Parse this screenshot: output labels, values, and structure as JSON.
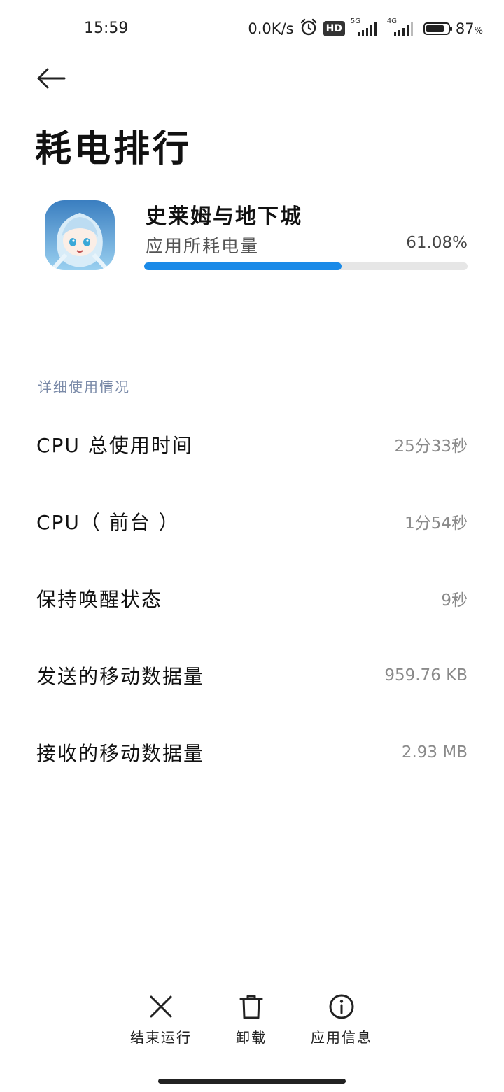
{
  "status_bar": {
    "time": "15:59",
    "network_speed": "0.0K/s",
    "hd_badge": "HD",
    "signal_1_label": "5G",
    "signal_2_label": "4G",
    "battery_level": 0.87,
    "battery_text": "87",
    "battery_unit": "%"
  },
  "header": {
    "title": "耗电排行"
  },
  "app": {
    "name": "史莱姆与地下城",
    "usage_label": "应用所耗电量",
    "usage_value": "61.08%",
    "usage_fraction": 0.6108
  },
  "details": {
    "section_title": "详细使用情况",
    "rows": [
      {
        "label": "CPU 总使用时间",
        "value": "25分33秒"
      },
      {
        "label": "CPU（ 前台 ）",
        "value": "1分54秒"
      },
      {
        "label": "保持唤醒状态",
        "value": "9秒"
      },
      {
        "label": "发送的移动数据量",
        "value": "959.76 KB"
      },
      {
        "label": "接收的移动数据量",
        "value": "2.93 MB"
      }
    ]
  },
  "actions": {
    "stop_label": "结束运行",
    "uninstall_label": "卸载",
    "info_label": "应用信息"
  },
  "colors": {
    "progress_fill": "#1a8ae8",
    "progress_track": "#e6e6e6",
    "section_title": "#7a8aa8"
  }
}
